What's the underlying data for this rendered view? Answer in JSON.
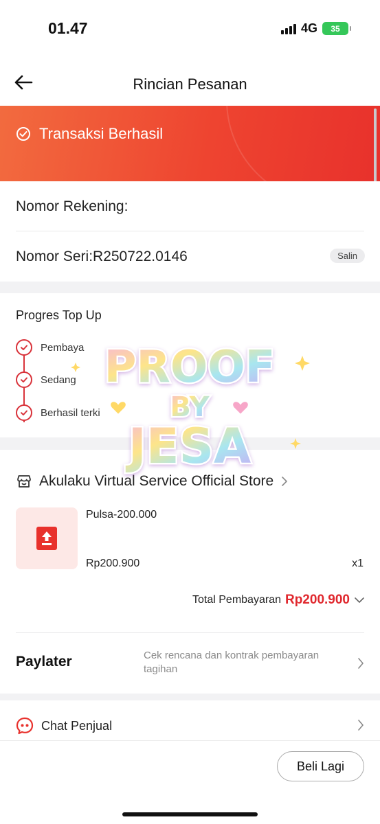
{
  "status_bar": {
    "time": "01.47",
    "network": "4G",
    "battery": "35"
  },
  "nav": {
    "title": "Rincian Pesanan"
  },
  "banner": {
    "status": "Transaksi Berhasil"
  },
  "account": {
    "account_label": "Nomor Rekening:",
    "serial_label": "Nomor Seri:R250722.0146",
    "copy_label": "Salin"
  },
  "progress": {
    "title": "Progres Top Up",
    "steps": [
      {
        "label": "Pembaya"
      },
      {
        "label": "Sedang"
      },
      {
        "label": "Berhasil terki"
      }
    ]
  },
  "order": {
    "store_name": "Akulaku Virtual Service Official Store",
    "product_name": "Pulsa-200.000",
    "price": "Rp200.900",
    "quantity": "x1",
    "total_label": "Total Pembayaran",
    "total_value": "Rp200.900"
  },
  "paylater": {
    "title": "Paylater",
    "description": "Cek rencana dan kontrak pembayaran tagihan"
  },
  "chat": {
    "label": "Chat Penjual"
  },
  "footer": {
    "buy_again_label": "Beli Lagi"
  },
  "watermark": {
    "line1": "PROOF",
    "line2": "BY",
    "line3": "JESA"
  },
  "colors": {
    "accent_red": "#e0282e",
    "banner_gradient_start": "#f26b3f",
    "banner_gradient_end": "#e8312c",
    "battery_green": "#35c759"
  }
}
